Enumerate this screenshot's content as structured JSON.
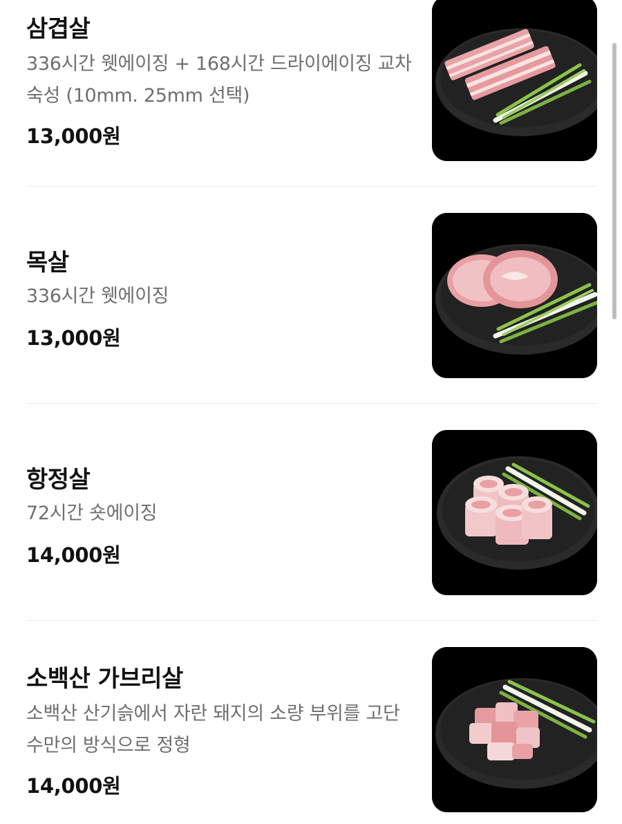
{
  "menu": {
    "items": [
      {
        "name": "삼겹살",
        "description": "336시간 웻에이징 + 168시간 드라이에이징 교차숙성 (10mm. 25mm 선택)",
        "price": "13,000원",
        "image_icon": "pork-belly-photo"
      },
      {
        "name": "목살",
        "description": "336시간 웻에이징",
        "price": "13,000원",
        "image_icon": "pork-neck-photo"
      },
      {
        "name": "항정살",
        "description": "72시간 숏에이징",
        "price": "14,000원",
        "image_icon": "pork-jowl-photo"
      },
      {
        "name": "소백산 가브리살",
        "description": "소백산 산기슭에서 자란 돼지의 소량 부위를 고단수만의 방식으로 정형",
        "price": "14,000원",
        "image_icon": "pork-gabrisal-photo"
      }
    ]
  },
  "colors": {
    "text_primary": "#111111",
    "text_secondary": "#6f6f6f",
    "divider": "#ececec",
    "thumb_bg": "#000000",
    "plate": "#2a2a2a",
    "meat": "#e9a3a6",
    "fat": "#f7e4e2",
    "scallion": "#8bc34a"
  }
}
